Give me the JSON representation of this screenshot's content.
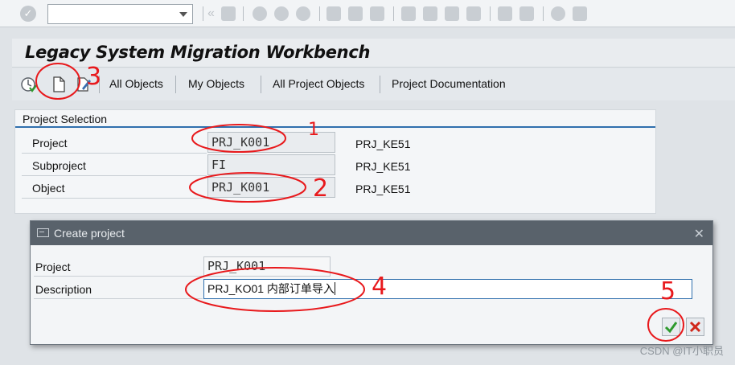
{
  "window": {
    "title": "Legacy System Migration Workbench"
  },
  "system_toolbar": {
    "command_field_value": "",
    "icons": [
      "ok-icon",
      "back-icon",
      "save-icon",
      "exit-icon",
      "cancel-icon",
      "print-icon",
      "find-icon",
      "find-next-icon",
      "first-page-icon",
      "previous-page-icon",
      "next-page-icon",
      "last-page-icon",
      "new-session-icon",
      "shortcut-icon",
      "help-icon",
      "customize-icon"
    ]
  },
  "app_toolbar": {
    "icons": [
      "execute-icon",
      "create-icon",
      "edit-icon"
    ],
    "buttons": [
      "All Objects",
      "My Objects",
      "All Project Objects",
      "Project Documentation"
    ]
  },
  "project_selection": {
    "title": "Project Selection",
    "rows": [
      {
        "label": "Project",
        "value": "PRJ_K001",
        "description": "PRJ_KE51"
      },
      {
        "label": "Subproject",
        "value": "FI",
        "description": "PRJ_KE51"
      },
      {
        "label": "Object",
        "value": "PRJ_K001",
        "description": "PRJ_KE51"
      }
    ]
  },
  "dialog": {
    "title": "Create project",
    "project_label": "Project",
    "project_value": "PRJ_K001",
    "description_label": "Description",
    "description_value": "PRJ_KO01  内部订单导入",
    "confirm_icon": "checkmark-icon",
    "cancel_icon": "cancel-x-icon"
  },
  "annotations": {
    "color": "#e8191c",
    "numbers": [
      "1",
      "2",
      "3",
      "4",
      "5"
    ]
  },
  "watermark": "CSDN @IT小职员"
}
